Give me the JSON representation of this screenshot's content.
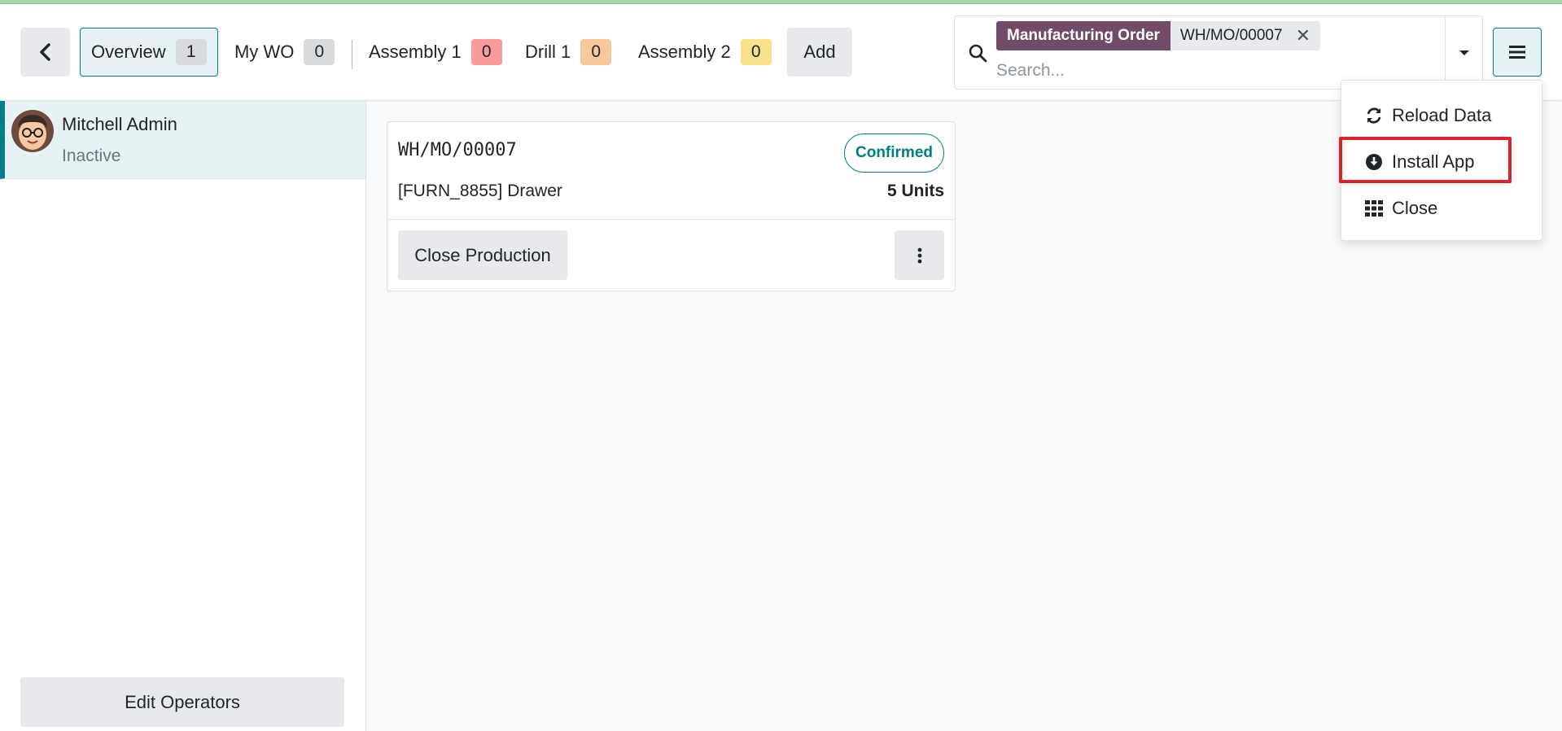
{
  "header": {
    "tabs": [
      {
        "label": "Overview",
        "count": "1"
      },
      {
        "label": "My WO",
        "count": "0"
      },
      {
        "label": "Assembly 1",
        "count": "0"
      },
      {
        "label": "Drill 1",
        "count": "0"
      },
      {
        "label": "Assembly 2",
        "count": "0"
      }
    ],
    "add_label": "Add"
  },
  "search": {
    "facet_label": "Manufacturing Order",
    "facet_value": "WH/MO/00007",
    "placeholder": "Search..."
  },
  "menu": {
    "items": [
      {
        "label": "Reload Data",
        "icon": "refresh-icon"
      },
      {
        "label": "Install App",
        "icon": "download-circle-icon"
      },
      {
        "label": "Close",
        "icon": "grid-icon"
      }
    ]
  },
  "sidebar": {
    "operator_name": "Mitchell Admin",
    "operator_status": "Inactive",
    "edit_label": "Edit Operators"
  },
  "card": {
    "title": "WH/MO/00007",
    "status": "Confirmed",
    "product": "[FURN_8855] Drawer",
    "quantity": "5 Units",
    "close_label": "Close Production"
  },
  "colors": {
    "accent": "#017e84",
    "facet": "#714b67",
    "highlight": "#e0202f"
  }
}
